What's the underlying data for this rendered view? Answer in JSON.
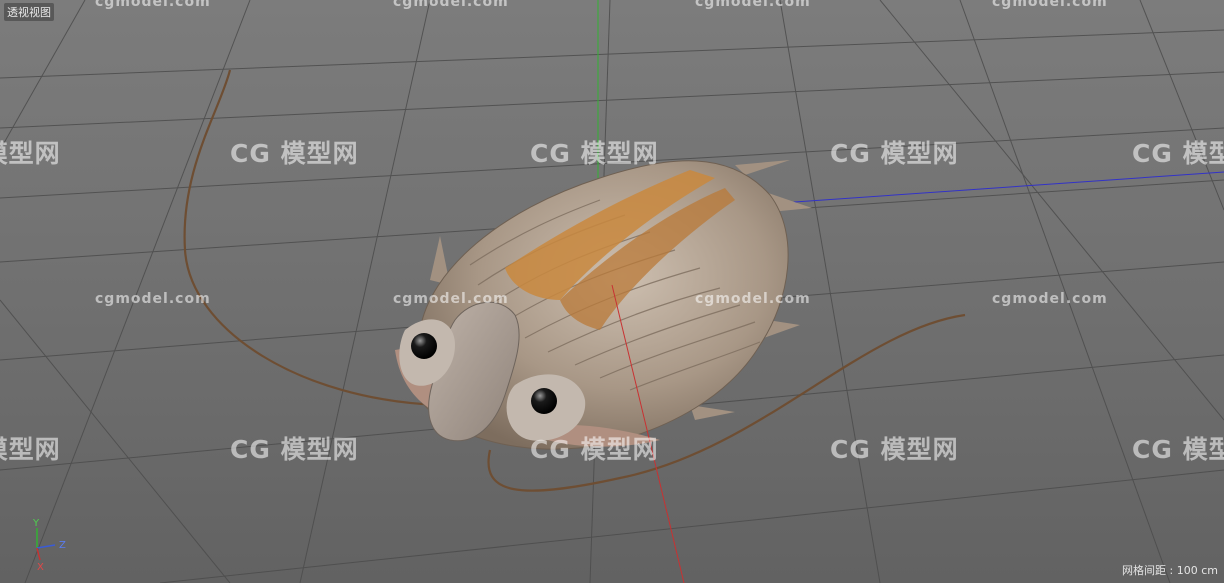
{
  "viewport": {
    "label": "透视视图",
    "grid_spacing": "网格间距 : 100 cm"
  },
  "axis_gizmo": {
    "y": "Y",
    "z": "Z",
    "x": "X"
  },
  "watermark": {
    "logo": "CG 模型网",
    "url": "cgmodel.com"
  },
  "scene": {
    "object": "trilobite-model",
    "icon": "trilobite-icon"
  },
  "colors": {
    "axis_x": "#c83232",
    "axis_y": "#33b233",
    "axis_z": "#3232c8",
    "shell": "#a39382",
    "stripe": "#c9883e",
    "eye": "#111111"
  }
}
